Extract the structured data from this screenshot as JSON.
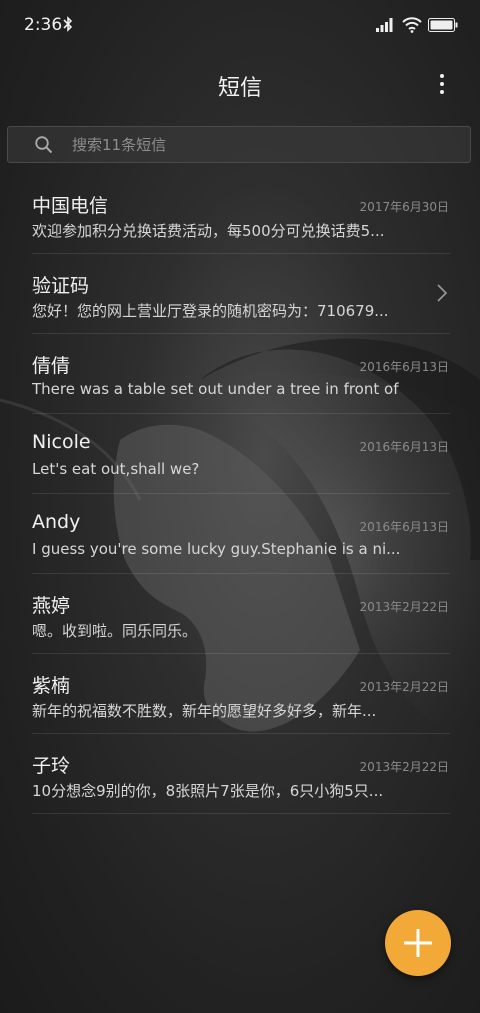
{
  "status_bar": {
    "time": "2:36",
    "icons": [
      "bluetooth-icon",
      "signal-icon",
      "wifi-icon",
      "battery-icon"
    ]
  },
  "header": {
    "title": "短信",
    "more_icon": "more-vertical-icon"
  },
  "search": {
    "placeholder": "搜索11条短信",
    "value": "",
    "icon": "search-icon"
  },
  "messages": [
    {
      "name": "中国电信",
      "preview": "欢迎参加积分兑换话费活动，每500分可兑换话费5...",
      "date": "2017年6月30日"
    },
    {
      "name": "验证码",
      "preview": "您好！您的网上营业厅登录的随机密码为：710679...",
      "date": ""
    },
    {
      "name": "倩倩",
      "preview": "There was a table set out under a tree in front of ...",
      "date": "2016年6月13日"
    },
    {
      "name": "Nicole",
      "preview": "Let's eat out,shall we?",
      "date": "2016年6月13日"
    },
    {
      "name": "Andy",
      "preview": "I guess you're some lucky guy.Stephanie is a ni...",
      "date": "2016年6月13日"
    },
    {
      "name": "燕婷",
      "preview": "嗯。收到啦。同乐同乐。",
      "date": "2013年2月22日"
    },
    {
      "name": "紫楠",
      "preview": "新年的祝福数不胜数，新年的愿望好多好多，新年...",
      "date": "2013年2月22日"
    },
    {
      "name": "子玲",
      "preview": "10分想念9别的你，8张照片7张是你，6只小狗5只...",
      "date": "2013年2月22日"
    }
  ],
  "fab": {
    "icon": "plus-icon"
  },
  "colors": {
    "accent": "#f2a937",
    "background": "#262626"
  }
}
